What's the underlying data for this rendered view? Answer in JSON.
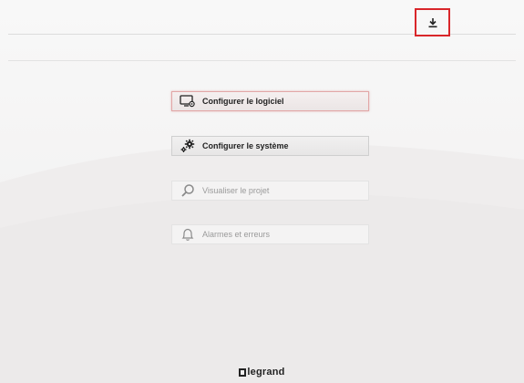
{
  "toolbar": {
    "download_icon": "download-icon"
  },
  "menu": {
    "items": [
      {
        "label": "Configurer le logiciel",
        "icon": "monitor-gear-icon",
        "state": "active"
      },
      {
        "label": "Configurer le système",
        "icon": "gears-icon",
        "state": "enabled"
      },
      {
        "label": "Visualiser le projet",
        "icon": "search-icon",
        "state": "disabled"
      },
      {
        "label": "Alarmes et erreurs",
        "icon": "bell-icon",
        "state": "disabled"
      }
    ]
  },
  "footer": {
    "brand": "legrand"
  },
  "colors": {
    "highlight": "#d9262a",
    "text": "#222222",
    "disabled_text": "#9a9a9a"
  }
}
